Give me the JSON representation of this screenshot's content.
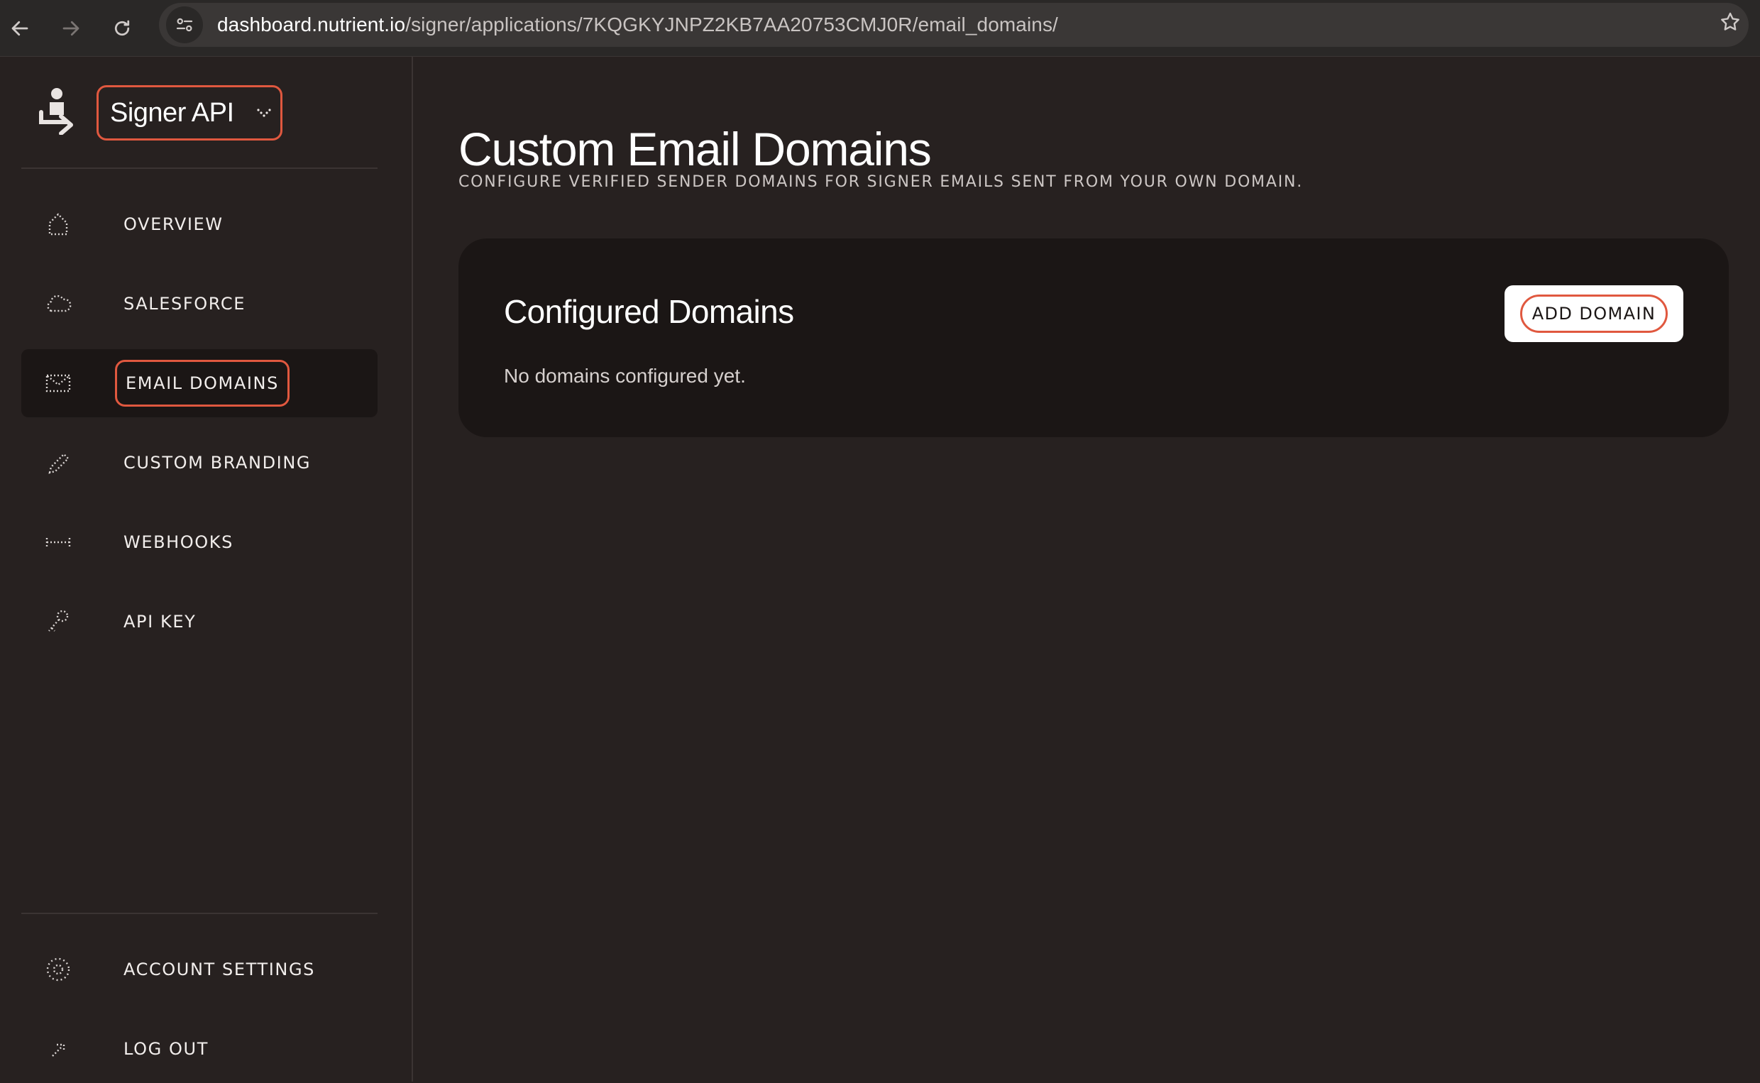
{
  "browser": {
    "url_host": "dashboard.nutrient.io",
    "url_path": "/signer/applications/7KQGKYJNPZ2KB7AA20753CMJ0R/email_domains/",
    "icons": {
      "back": "arrow-left-icon",
      "forward": "arrow-right-icon",
      "reload": "reload-icon",
      "site_info": "tune-icon",
      "bookmark": "star-icon"
    }
  },
  "sidebar": {
    "app_name": "Signer API",
    "nav_items": [
      {
        "label": "OVERVIEW",
        "icon": "home-icon"
      },
      {
        "label": "SALESFORCE",
        "icon": "cloud-icon"
      },
      {
        "label": "EMAIL DOMAINS",
        "icon": "envelope-icon",
        "active": true
      },
      {
        "label": "CUSTOM BRANDING",
        "icon": "pencil-icon"
      },
      {
        "label": "WEBHOOKS",
        "icon": "webhook-icon"
      },
      {
        "label": "API KEY",
        "icon": "key-icon"
      }
    ],
    "footer_items": [
      {
        "label": "ACCOUNT SETTINGS",
        "icon": "gear-icon"
      },
      {
        "label": "LOG OUT",
        "icon": "logout-icon"
      }
    ]
  },
  "main": {
    "title": "Custom Email Domains",
    "subtitle": "CONFIGURE VERIFIED SENDER DOMAINS FOR SIGNER EMAILS SENT FROM YOUR OWN DOMAIN.",
    "card": {
      "title": "Configured Domains",
      "empty_text": "No domains configured yet.",
      "add_button": "ADD DOMAIN"
    }
  },
  "colors": {
    "background": "#272120",
    "card": "#1b1615",
    "accent_outline": "#e0583f",
    "text": "#ffffff"
  }
}
